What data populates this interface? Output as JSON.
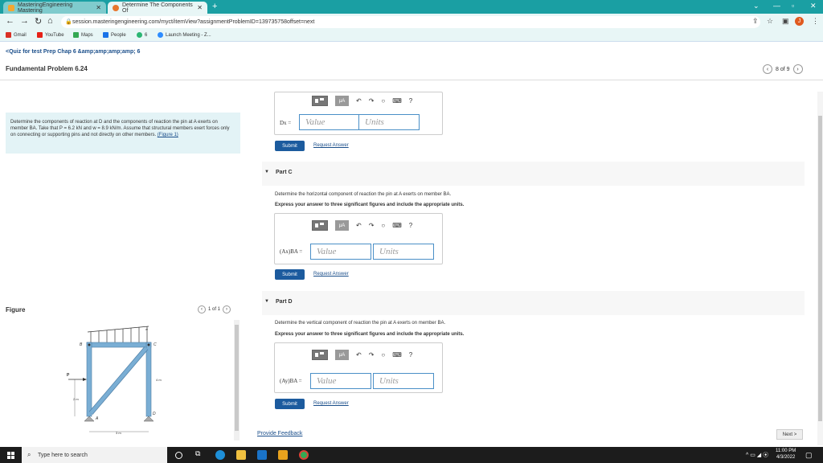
{
  "browser": {
    "tabs": [
      {
        "label": "MasteringEngineering Mastering",
        "close": "✕"
      },
      {
        "label": "Determine The Components Of",
        "close": "✕"
      }
    ],
    "new_tab": "+",
    "url": "session.masteringengineering.com/myct/itemView?assignmentProblemID=139735758offset=next",
    "bookmarks": [
      "Gmail",
      "YouTube",
      "Maps",
      "People",
      "6",
      "Launch Meeting - Z..."
    ],
    "profile_initial": "J"
  },
  "page": {
    "quiz_link": "<Quiz for test Prep Chap 6 &amp;amp;amp;amp; 6",
    "problem_title": "Fundamental Problem 6.24",
    "pager": "8 of 9",
    "problem_text": "Determine the components of reaction at D and the components of reaction the pin at A exerts on member BA. Take that P = 6.2 kN and w = 8.9 kN/m. Assume that structural members exert forces only on connecting or supporting pins and not directly on other members.",
    "figure_link": "(Figure 1)",
    "figure_title": "Figure",
    "figure_pager": "1 of 1",
    "figure_labels": {
      "w": "w",
      "B": "B",
      "C": "C",
      "P": "P",
      "h": "4 m",
      "a": "2 m",
      "base": "3 m",
      "D": "D",
      "A": "A"
    }
  },
  "parts": [
    {
      "id": "B",
      "var": "Dx =",
      "value_placeholder": "Value",
      "units_placeholder": "Units",
      "submit": "Submit",
      "request": "Request Answer",
      "mu": "μA",
      "help": "?"
    },
    {
      "id": "C",
      "label": "Part C",
      "description": "Determine the horizontal component of reaction the pin at A exerts on member BA.",
      "instruction": "Express your answer to three significant figures and include the appropriate units.",
      "var": "(Ax)BA =",
      "value_placeholder": "Value",
      "units_placeholder": "Units",
      "submit": "Submit",
      "request": "Request Answer",
      "mu": "μA",
      "help": "?"
    },
    {
      "id": "D",
      "label": "Part D",
      "description": "Determine the vertical component of reaction the pin at A exerts on member BA.",
      "instruction": "Express your answer to three significant figures and include the appropriate units.",
      "var": "(Ay)BA =",
      "value_placeholder": "Value",
      "units_placeholder": "Units",
      "submit": "Submit",
      "request": "Request Answer",
      "mu": "μA",
      "help": "?"
    }
  ],
  "footer": {
    "feedback": "Provide Feedback",
    "next": "Next >"
  },
  "taskbar": {
    "search_placeholder": "Type here to search",
    "time": "11:00 PM",
    "date": "4/3/2022"
  }
}
